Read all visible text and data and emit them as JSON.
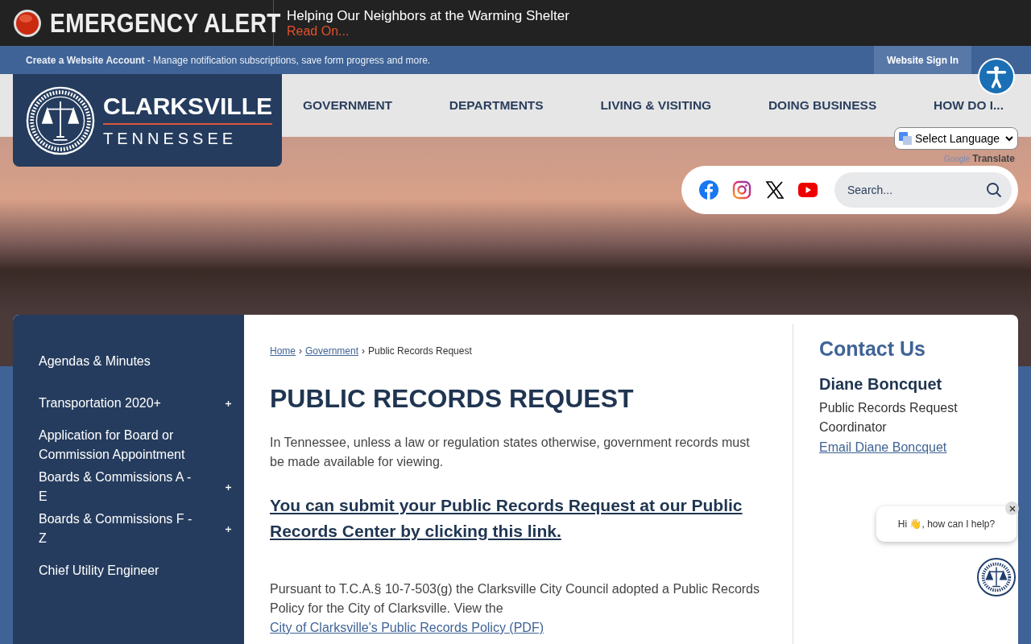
{
  "alert": {
    "label": "EMERGENCY ALERT",
    "headline": "Helping Our Neighbors at the Warming Shelter",
    "link": "Read On..."
  },
  "account_bar": {
    "link": "Create a Website Account",
    "text": " - Manage notification subscriptions, save form progress and more.",
    "sign_in": "Website Sign In"
  },
  "logo": {
    "name": "CLARKSVILLE",
    "state": "TENNESSEE"
  },
  "nav": [
    "GOVERNMENT",
    "DEPARTMENTS",
    "LIVING & VISITING",
    "DOING BUSINESS",
    "HOW DO I..."
  ],
  "translate": {
    "select": "Select Language",
    "powered_by": "Google",
    "label": "Translate"
  },
  "search": {
    "placeholder": "Search..."
  },
  "sidebar": [
    {
      "label": "Agendas & Minutes",
      "has_children": false
    },
    {
      "label": "Transportation 2020+",
      "has_children": true
    },
    {
      "label": "Application for Board or Commission Appointment",
      "has_children": false
    },
    {
      "label": "Boards & Commissions A - E",
      "has_children": true
    },
    {
      "label": "Boards & Commissions F - Z",
      "has_children": true
    },
    {
      "label": "Chief Utility Engineer",
      "has_children": false
    }
  ],
  "breadcrumb": {
    "separator": "›",
    "items": [
      {
        "label": "Home",
        "link": true
      },
      {
        "label": "Government",
        "link": true
      },
      {
        "label": "Public Records Request",
        "link": false
      }
    ]
  },
  "page_title": "PUBLIC RECORDS REQUEST",
  "intro": "In Tennessee, unless a law or regulation states otherwise, government records must be made available for viewing.",
  "cta_link": "You can submit your Public Records Request at our Public Records Center by clicking this link.",
  "policy": {
    "text": "Pursuant to T.C.A.§ 10-7-503(g) the Clarksville City Council adopted a Public Records Policy for the City of Clarksville. View the ",
    "link": "City of Clarksville's Public Records Policy (PDF)"
  },
  "contact": {
    "heading": "Contact Us",
    "name": "Diane Boncquet",
    "role": "Public Records Request Coordinator",
    "email_link": "Email Diane Boncquet"
  },
  "chat": {
    "greeting": "Hi 👋, how can I help?"
  }
}
